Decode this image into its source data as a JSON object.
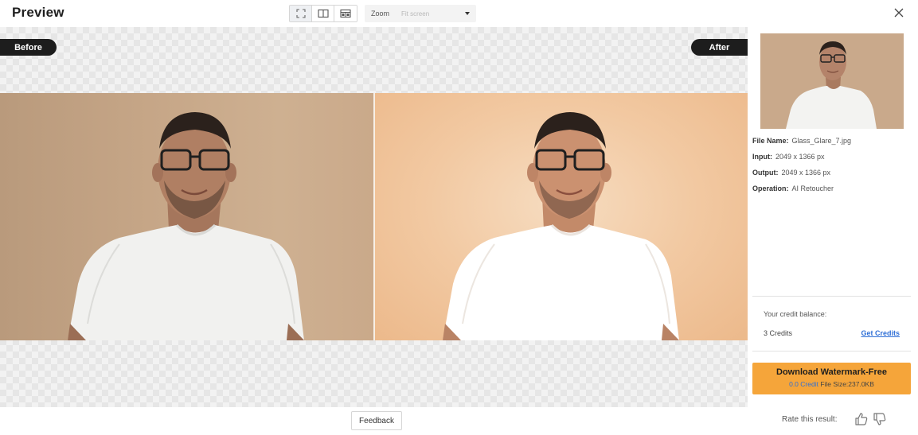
{
  "header": {
    "title": "Preview",
    "view_modes": [
      {
        "icon": "fullscreen-icon",
        "active": true
      },
      {
        "icon": "split-view-icon",
        "active": false
      },
      {
        "icon": "side-by-side-icon",
        "active": false
      }
    ],
    "zoom": {
      "label": "Zoom",
      "value": "Fit screen"
    },
    "close_icon": "close-icon"
  },
  "preview": {
    "before_label": "Before",
    "after_label": "After"
  },
  "panel": {
    "file_name_label": "File Name:",
    "file_name": "Glass_Glare_7.jpg",
    "input_label": "Input:",
    "input": "2049 x 1366 px",
    "output_label": "Output:",
    "output": "2049 x 1366 px",
    "operation_label": "Operation:",
    "operation": "AI Retoucher",
    "credit_balance_label": "Your credit balance:",
    "credits": "3 Credits",
    "get_credits": "Get Credits",
    "download_title": "Download Watermark-Free",
    "download_credit": "0.0 Credit",
    "download_size": "File Size:237.0KB"
  },
  "footer": {
    "feedback": "Feedback",
    "rate_label": "Rate this result:"
  },
  "colors": {
    "accent": "#f5a53a",
    "badge": "#1d1d1d",
    "link": "#2f6fd6"
  }
}
